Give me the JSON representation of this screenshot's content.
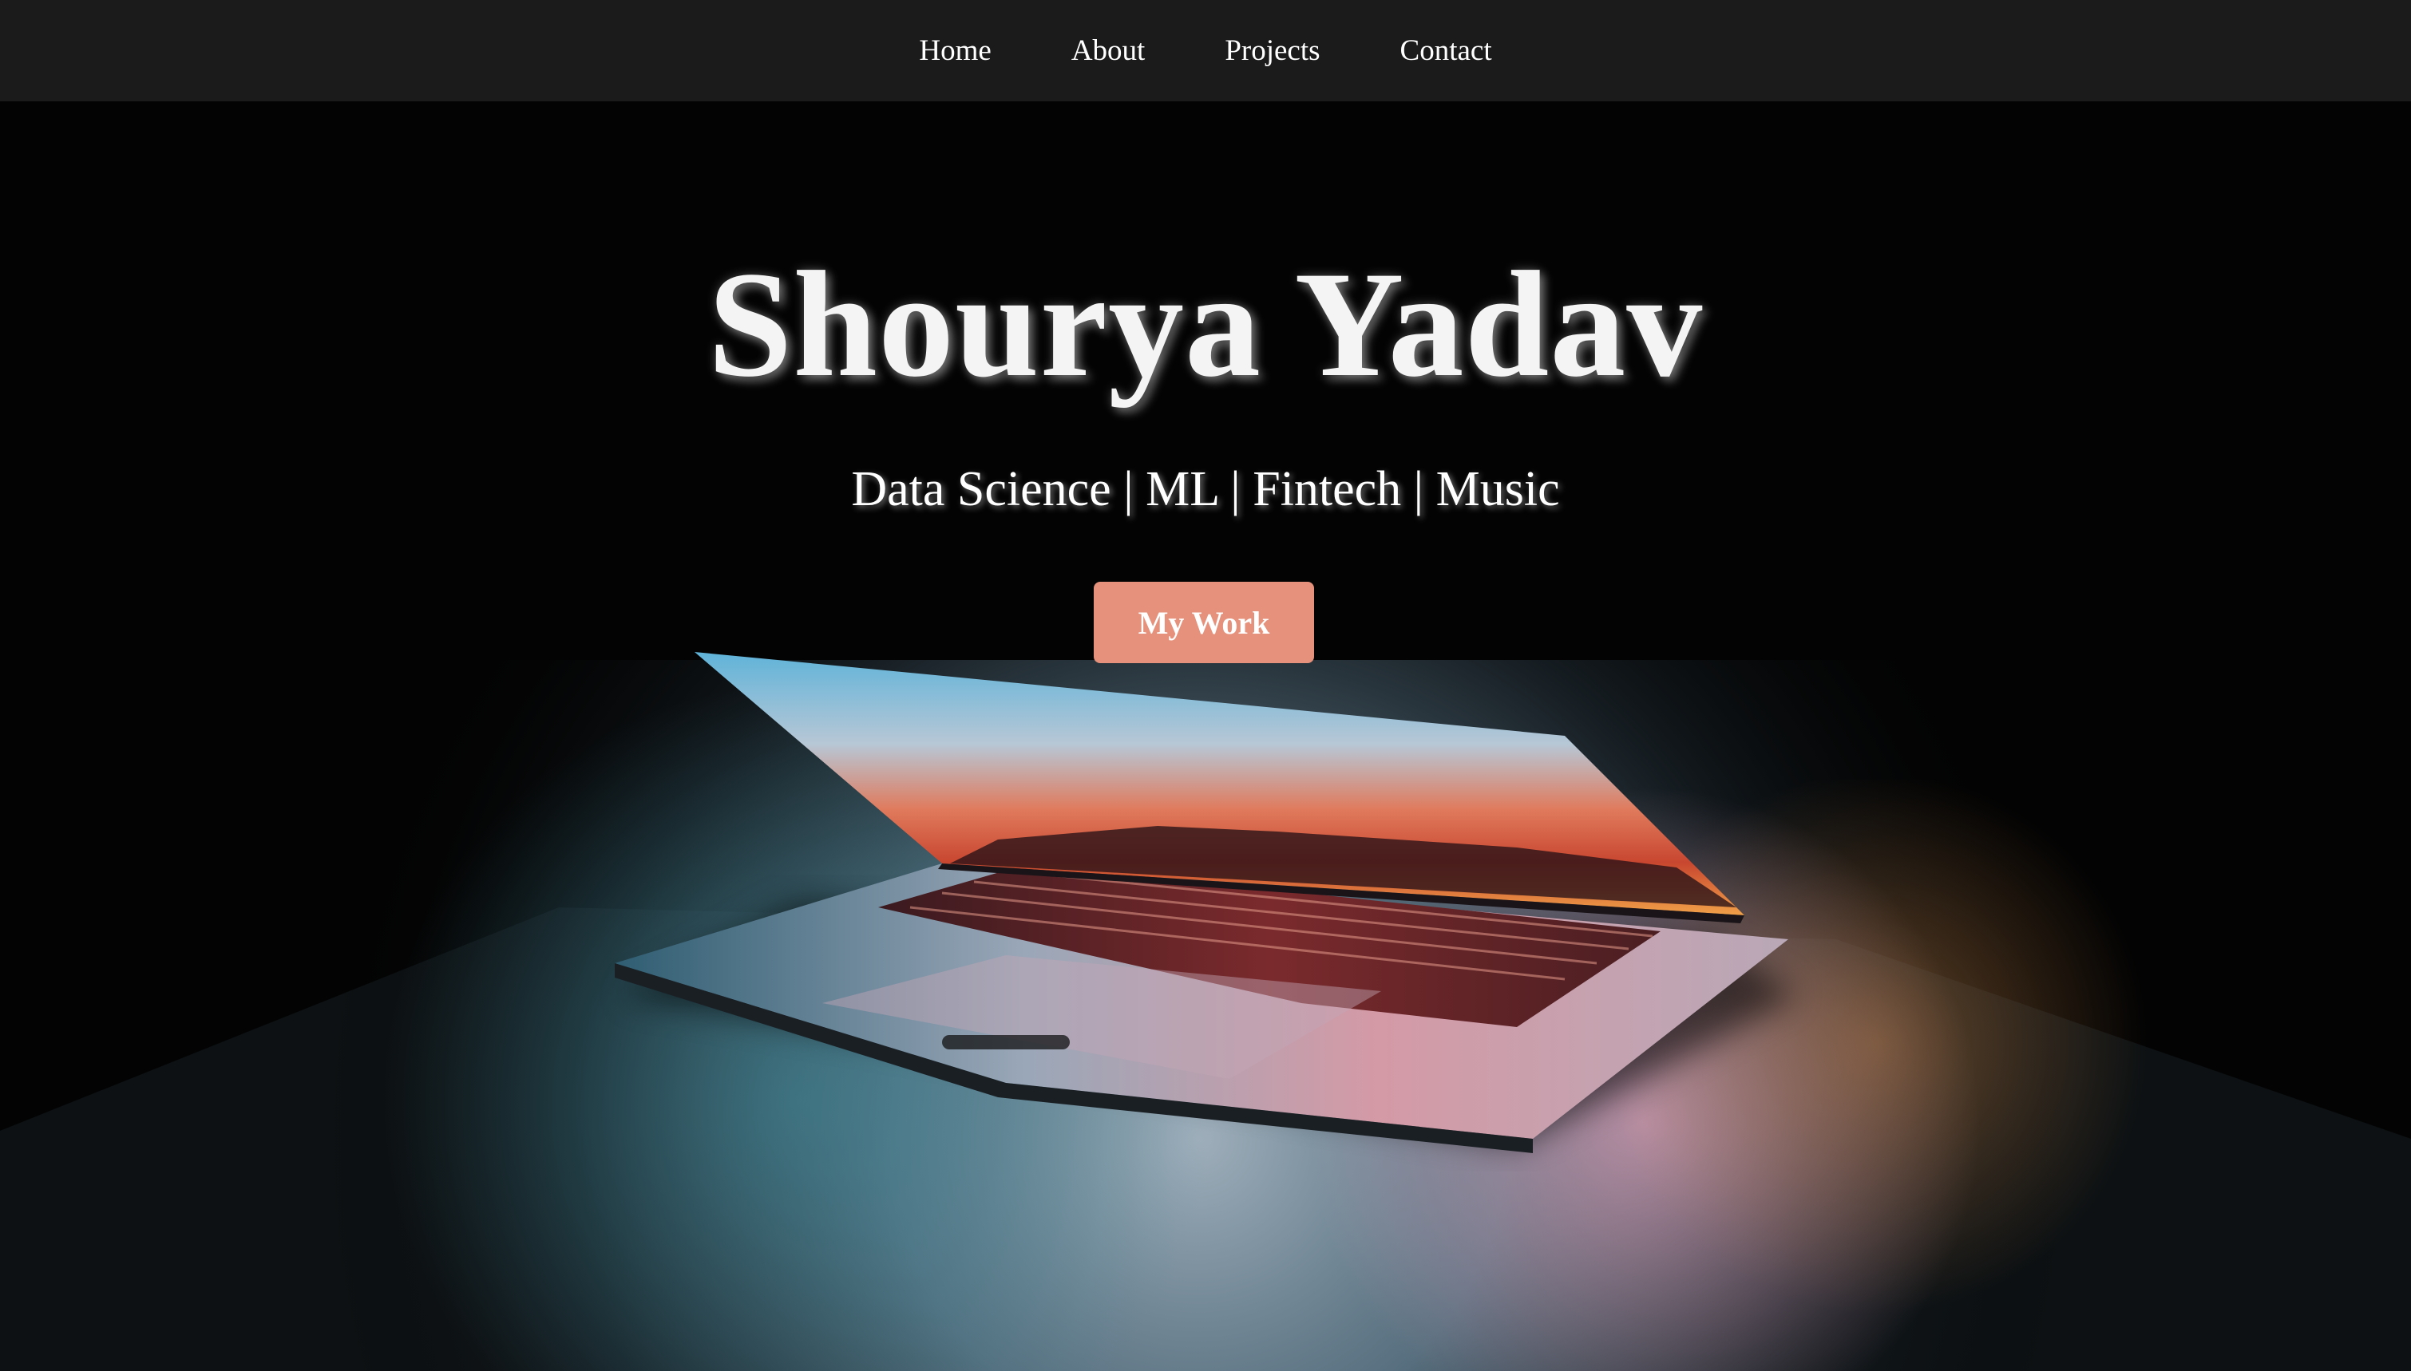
{
  "nav": {
    "items": [
      {
        "label": "Home"
      },
      {
        "label": "About"
      },
      {
        "label": "Projects"
      },
      {
        "label": "Contact"
      }
    ]
  },
  "hero": {
    "title": "Shourya Yadav",
    "subtitle": "Data Science | ML | Fintech | Music",
    "cta_label": "My Work",
    "background_image": "laptop-glowing-screen-photo"
  },
  "colors": {
    "nav_background": "#1b1b1b",
    "cta_background": "#e5917b",
    "text": "#ffffff"
  }
}
